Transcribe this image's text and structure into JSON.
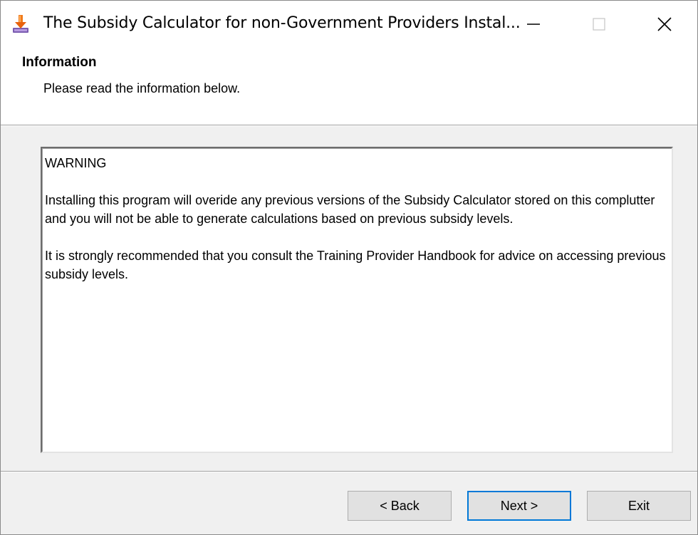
{
  "window": {
    "title": "The Subsidy Calculator for non-Government Providers Instal...",
    "controls": {
      "minimize": "minimize",
      "maximize": "maximize",
      "close": "close"
    },
    "icon": "installer-icon"
  },
  "header": {
    "title": "Information",
    "subtitle": "Please read the information below."
  },
  "info_text": {
    "heading": "WARNING",
    "paragraph1": "Installing this program will overide any previous versions of the Subsidy Calculator stored on this complutter and you will not be able to generate calculations based on previous subsidy levels.",
    "paragraph2": "It is strongly recommended that you consult the Training Provider Handbook for advice on accessing previous subsidy levels."
  },
  "buttons": {
    "back": "< Back",
    "next": "Next >",
    "exit": "Exit"
  },
  "colors": {
    "accent": "#0078d7",
    "dialog_bg": "#f0f0f0",
    "header_bg": "#ffffff"
  }
}
